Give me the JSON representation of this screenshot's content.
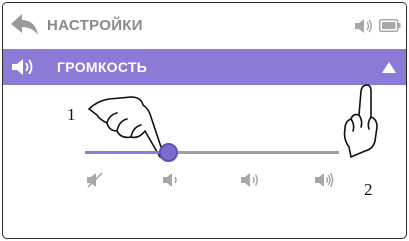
{
  "header": {
    "title": "НАСТРОЙКИ",
    "back_icon": "back-arrow-icon",
    "speaker_icon": "speaker-icon",
    "battery_icon": "battery-icon"
  },
  "volume_bar": {
    "label": "ГРОМКОСТЬ",
    "speaker_icon": "speaker-icon",
    "collapse_icon": "triangle-up-icon",
    "color": "#8b7ad6"
  },
  "slider": {
    "value": 0.33,
    "levels": [
      {
        "icon": "mute-icon"
      },
      {
        "icon": "volume-low-icon"
      },
      {
        "icon": "volume-medium-icon"
      },
      {
        "icon": "volume-high-icon"
      }
    ]
  },
  "callouts": {
    "first": "1",
    "second": "2"
  },
  "colors": {
    "accent": "#8b7ad6",
    "header_text": "#8a8a8a",
    "icon_gray": "#a8a8a8"
  }
}
